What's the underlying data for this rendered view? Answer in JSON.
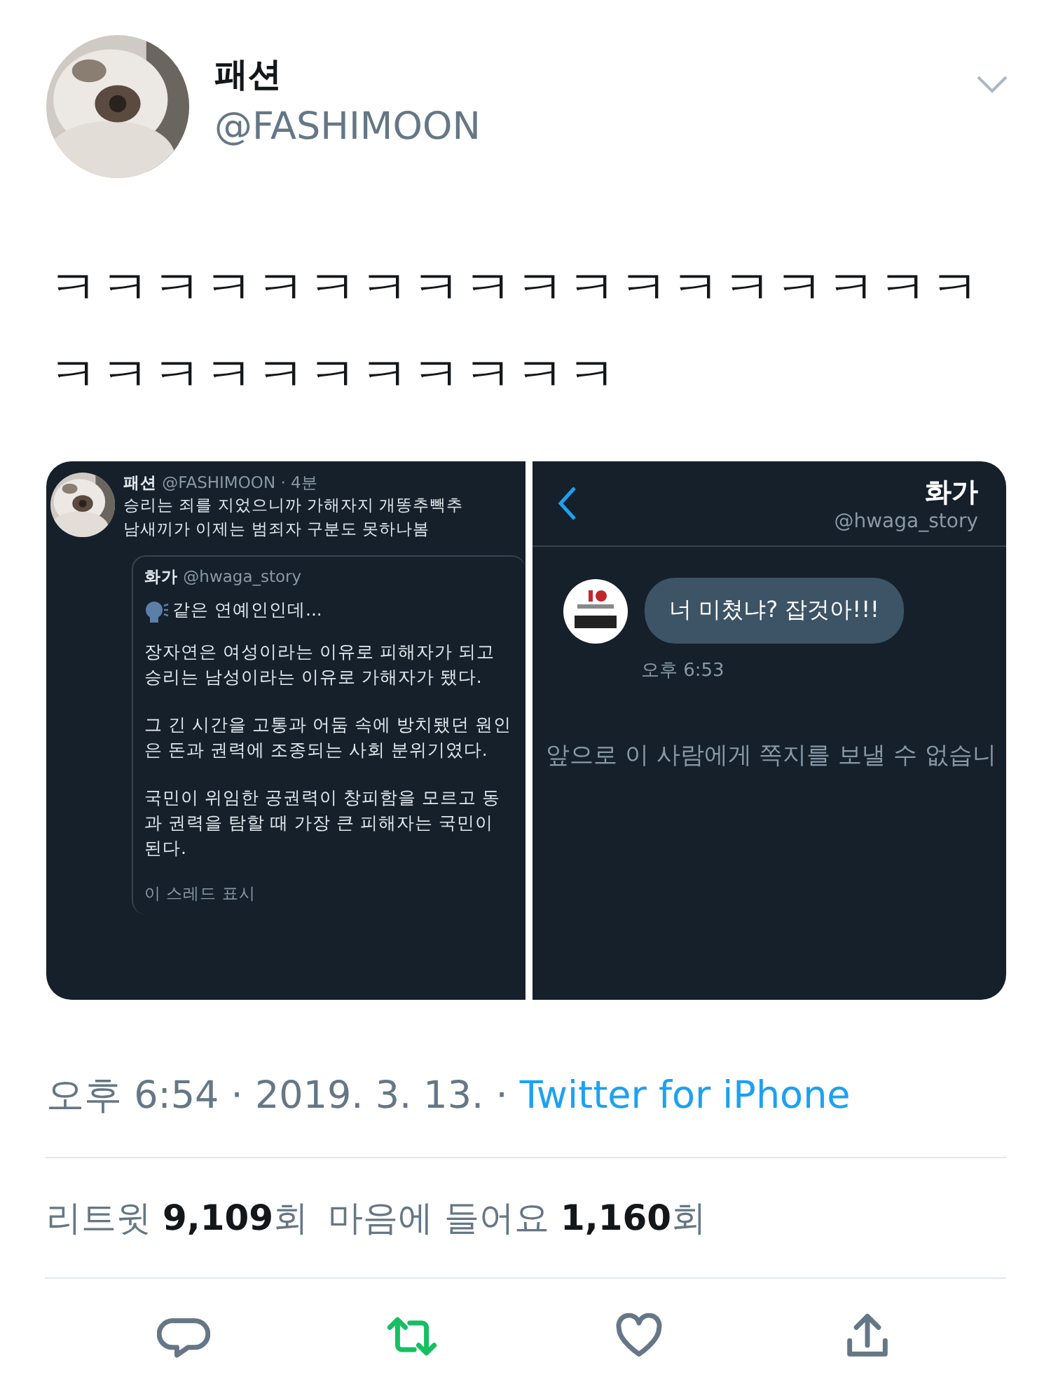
{
  "author": {
    "name": "패션",
    "handle": "@FASHIMOON"
  },
  "tweet_text": "ㅋㅋㅋㅋㅋㅋㅋㅋㅋㅋㅋㅋㅋㅋㅋㅋㅋㅋㅋㅋㅋㅋㅋㅋㅋㅋㅋㅋㅋ",
  "left_screenshot": {
    "name": "패션",
    "handle": "@FASHIMOON · 4분",
    "lines": [
      "승리는 죄를 지었으니까 가해자지 개똥추빽추",
      "남새끼가 이제는 범죄자 구분도 못하나봄"
    ],
    "quote": {
      "name": "화가",
      "handle": "@hwaga_story",
      "paragraphs": [
        "같은 연예인인데...",
        "장자연은 여성이라는 이유로 피해자가 되고 승리는 남성이라는 이유로 가해자가 됐다.",
        "그 긴 시간을 고통과 어둠 속에 방치됐던 원인은 돈과 권력에 조종되는 사회 분위기였다.",
        "국민이 위임한 공권력이 창피함을 모르고 동과 권력을 탐할 때 가장 큰 피해자는 국민이 된다."
      ],
      "show_thread": "이 스레드 표시"
    }
  },
  "right_screenshot": {
    "name": "화가",
    "handle": "@hwaga_story",
    "message": "너 미쳤냐? 잡것아!!!",
    "time": "오후 6:53",
    "notice": "앞으로 이 사람에게 쪽지를 보낼 수 없습니"
  },
  "timestamp": "오후 6:54 · 2019. 3. 13. · ",
  "source": "Twitter for iPhone",
  "stats": [
    {
      "label": "리트윗",
      "count": "9,109",
      "unit": "회"
    },
    {
      "label": "마음에 들어요",
      "count": "1,160",
      "unit": "회"
    }
  ],
  "actions": [
    {
      "kind": "reply"
    },
    {
      "kind": "retweet"
    },
    {
      "kind": "like"
    },
    {
      "kind": "share"
    }
  ]
}
